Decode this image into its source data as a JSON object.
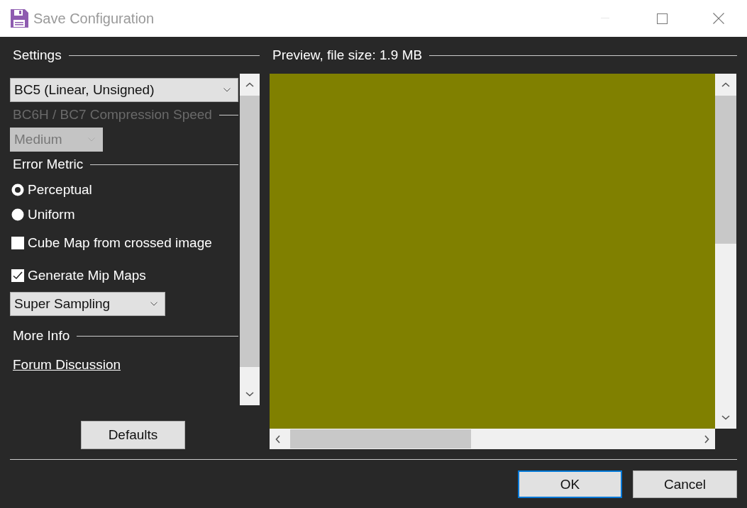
{
  "window": {
    "title": "Save Configuration"
  },
  "settings": {
    "title": "Settings",
    "format_dropdown": {
      "value": "BC5 (Linear, Unsigned)"
    },
    "compression_speed": {
      "label": "BC6H / BC7 Compression Speed",
      "disabled": true,
      "value": "Medium"
    },
    "error_metric": {
      "title": "Error Metric",
      "options": [
        {
          "label": "Perceptual",
          "selected": true
        },
        {
          "label": "Uniform",
          "selected": false
        }
      ]
    },
    "checkboxes": [
      {
        "label": "Cube Map from crossed image",
        "checked": false
      },
      {
        "label": "Generate Mip Maps",
        "checked": true
      }
    ],
    "mip_filter_dropdown": {
      "value": "Super Sampling"
    },
    "more_info": {
      "title": "More Info",
      "link": "Forum Discussion"
    },
    "defaults_button": "Defaults"
  },
  "preview": {
    "title": "Preview, file size: 1.9 MB"
  },
  "buttons": [
    {
      "label": "OK",
      "default": true
    },
    {
      "label": "Cancel",
      "default": false
    }
  ]
}
